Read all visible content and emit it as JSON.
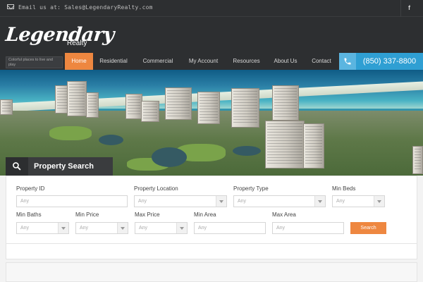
{
  "topbar": {
    "email_text": "Email us at: Sales@LegendaryRealty.com",
    "mail_icon": "envelope-icon",
    "social_icon": "facebook-icon",
    "social_glyph": "f"
  },
  "brand": {
    "logo": "Legendary",
    "logo_sub": "Realty",
    "tagline": "Colorful places to live and play"
  },
  "nav": {
    "items": [
      {
        "label": "Home",
        "active": true
      },
      {
        "label": "Residential",
        "active": false
      },
      {
        "label": "Commercial",
        "active": false
      },
      {
        "label": "My Account",
        "active": false
      },
      {
        "label": "Resources",
        "active": false
      },
      {
        "label": "About Us",
        "active": false
      },
      {
        "label": "Contact",
        "active": false
      }
    ],
    "phone": "(850) 337-8800",
    "phone_icon": "phone-icon"
  },
  "search": {
    "tab_label": "Property Search",
    "tab_icon": "search-icon",
    "fields": {
      "property_id": {
        "label": "Property ID",
        "placeholder": "Any"
      },
      "property_location": {
        "label": "Property Location",
        "value": "Any"
      },
      "property_type": {
        "label": "Property Type",
        "value": "Any"
      },
      "min_beds": {
        "label": "Min Beds",
        "value": "Any"
      },
      "min_baths": {
        "label": "Min Baths",
        "value": "Any"
      },
      "min_price": {
        "label": "Min Price",
        "value": "Any"
      },
      "max_price": {
        "label": "Max Price",
        "value": "Any"
      },
      "min_area": {
        "label": "Min Area",
        "placeholder": "Any"
      },
      "max_area": {
        "label": "Max Area",
        "placeholder": "Any"
      }
    },
    "button_label": "Search"
  },
  "colors": {
    "accent": "#ee8740",
    "phone_blue": "#2f9fd3",
    "header_dark": "#2d2f31"
  }
}
